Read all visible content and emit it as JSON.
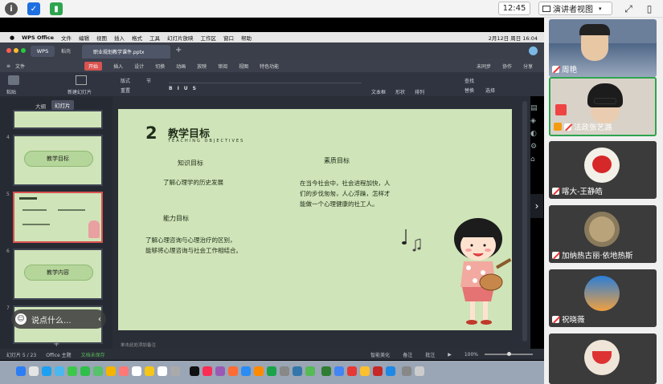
{
  "topbar": {
    "icons": [
      "info-icon",
      "shield-icon",
      "signal-icon"
    ],
    "clock": "12:45",
    "view_mode": "演讲者视图",
    "right_icons": [
      "fullscreen-icon",
      "sidebar-icon"
    ]
  },
  "mac_menu": {
    "items": [
      "WPS Office",
      "文件",
      "编辑",
      "视图",
      "插入",
      "格式",
      "工具",
      "幻灯片放映",
      "工作区",
      "窗口",
      "帮助"
    ],
    "datetime": "2月12日 周日 16:04"
  },
  "wps": {
    "app_tab": "WPS",
    "tabs": [
      "稻壳",
      "职业规划教学课件.pptx"
    ],
    "toolbar": [
      "文件",
      "开始",
      "插入",
      "设计",
      "切换",
      "动画",
      "放映",
      "审阅",
      "视图",
      "特色功能"
    ],
    "active_tab": "开始",
    "right_actions": [
      "未同步",
      "协作",
      "分享"
    ],
    "ribbon": [
      "粘贴",
      "新建幻灯片",
      "版式",
      "重置",
      "节",
      "文本框",
      "形状",
      "排列",
      "查找",
      "替换",
      "选择"
    ],
    "left_tabs": [
      "大纲",
      "幻灯片"
    ],
    "note_placeholder": "单击此处添加备注",
    "status_left": [
      "幻灯片 5 / 23",
      "Office 主题",
      "文档未保存"
    ],
    "status_right": [
      "智能美化",
      "备注",
      "批注",
      "100%"
    ]
  },
  "slide": {
    "number": "2",
    "title": "教学目标",
    "subtitle": "TEACHING OBJECTIVES",
    "knowledge_heading": "知识目标",
    "knowledge_text": "了解心理学的历史发展",
    "ability_heading": "能力目标",
    "ability_text_1": "了解心理咨询与心理治疗的区别，",
    "ability_text_2": "能够将心理咨询与社会工作相结合。",
    "quality_heading": "素质目标",
    "quality_text_1": "在当今社会中，社会进程加快，人",
    "quality_text_2": "们的步伐匆匆，人心浮躁，怎样才",
    "quality_text_3": "能做一个心理健康的社工人。"
  },
  "thumbnails": [
    {
      "index": "4",
      "label": "教学目标"
    },
    {
      "index": "5",
      "label": ""
    },
    {
      "index": "6",
      "label": "教学内容"
    },
    {
      "index": "7",
      "label": ""
    }
  ],
  "chat": {
    "placeholder": "说点什么..."
  },
  "participants": [
    {
      "name": "周艳",
      "bg": "#6b7f9a"
    },
    {
      "name": "法政张艺潞",
      "bg": "#d9d2c8"
    },
    {
      "name": "喀大-王静皓",
      "bg": "#3b3b3b"
    },
    {
      "name": "加纳热古丽·依地热斯",
      "bg": "#3b3b3b"
    },
    {
      "name": "祝晓薇",
      "bg": "#3b3b3b"
    },
    {
      "name": "",
      "bg": "#3b3b3b"
    }
  ]
}
